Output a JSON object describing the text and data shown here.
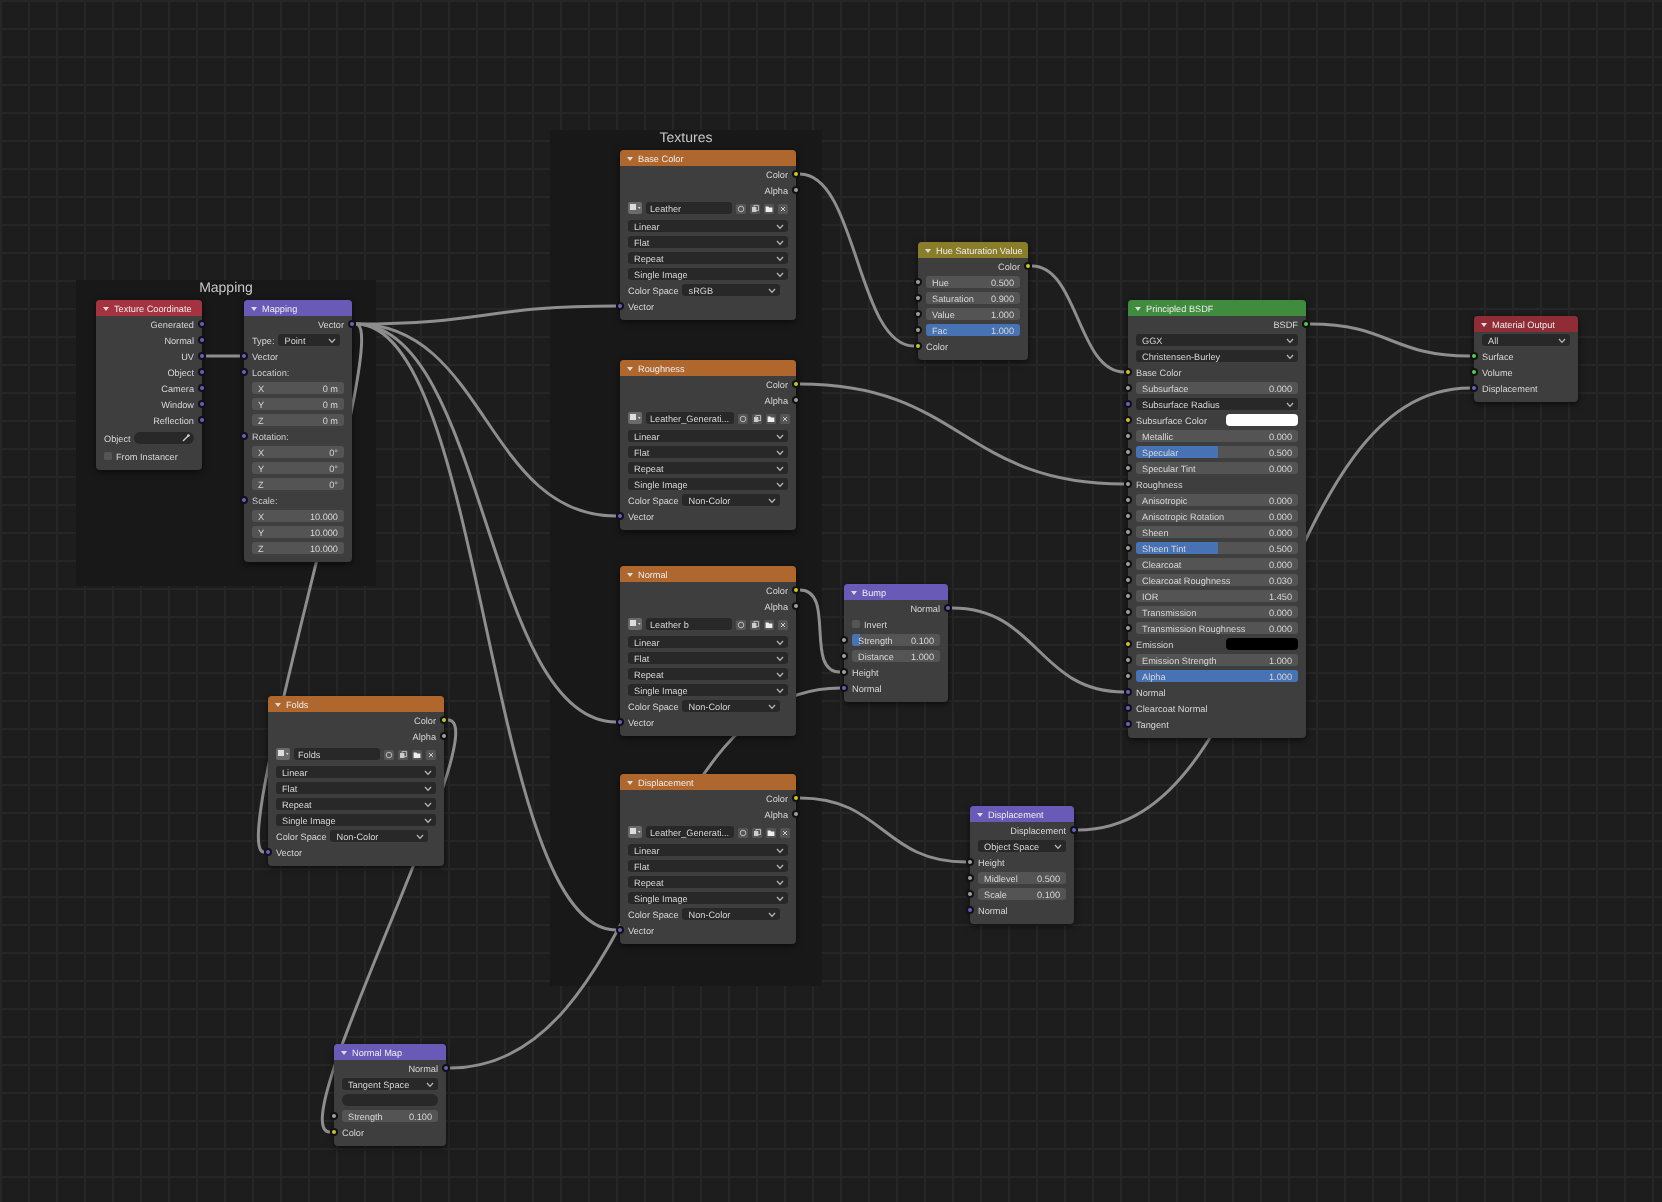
{
  "frames": [
    {
      "label": "Mapping"
    },
    {
      "label": "Textures"
    }
  ],
  "nodes": [
    {
      "title": "Texture Coordinate",
      "kind": "input",
      "rows": [
        {
          "kind": "output",
          "label": "Generated",
          "socket": {
            "kind": "vector"
          }
        },
        {
          "kind": "output",
          "label": "Normal",
          "socket": {
            "kind": "vector"
          }
        },
        {
          "kind": "output",
          "label": "UV",
          "socket": {
            "kind": "vector"
          }
        },
        {
          "kind": "output",
          "label": "Object",
          "socket": {
            "kind": "vector"
          }
        },
        {
          "kind": "output",
          "label": "Camera",
          "socket": {
            "kind": "vector"
          }
        },
        {
          "kind": "output",
          "label": "Window",
          "socket": {
            "kind": "vector"
          }
        },
        {
          "kind": "output",
          "label": "Reflection",
          "socket": {
            "kind": "vector"
          }
        },
        {
          "kind": "object",
          "label": "Object"
        },
        {
          "kind": "checkbox",
          "label": "From Instancer",
          "checked": false
        }
      ]
    },
    {
      "title": "Mapping",
      "kind": "vector",
      "rows": [
        {
          "kind": "output",
          "label": "Vector",
          "socket": {
            "kind": "vector"
          }
        },
        {
          "kind": "labeled_dropdown",
          "label": "Type:",
          "value": "Point"
        },
        {
          "kind": "input",
          "label": "Vector",
          "socket": {
            "kind": "vector"
          }
        },
        {
          "kind": "subheader",
          "label": "Location:",
          "socket": {
            "kind": "vector"
          }
        },
        {
          "kind": "value",
          "label": "X",
          "value": "0 m"
        },
        {
          "kind": "value",
          "label": "Y",
          "value": "0 m"
        },
        {
          "kind": "value",
          "label": "Z",
          "value": "0 m"
        },
        {
          "kind": "subheader",
          "label": "Rotation:",
          "socket": {
            "kind": "vector"
          }
        },
        {
          "kind": "value",
          "label": "X",
          "value": "0°"
        },
        {
          "kind": "value",
          "label": "Y",
          "value": "0°"
        },
        {
          "kind": "value",
          "label": "Z",
          "value": "0°"
        },
        {
          "kind": "subheader",
          "label": "Scale:",
          "socket": {
            "kind": "vector"
          }
        },
        {
          "kind": "value",
          "label": "X",
          "value": "10.000"
        },
        {
          "kind": "value",
          "label": "Y",
          "value": "10.000"
        },
        {
          "kind": "value",
          "label": "Z",
          "value": "10.000"
        }
      ]
    },
    {
      "title": "Base Color",
      "kind": "texture",
      "rows": [
        {
          "kind": "output",
          "label": "Color",
          "socket": {
            "kind": "color"
          }
        },
        {
          "kind": "output",
          "label": "Alpha",
          "socket": {
            "kind": "float"
          }
        },
        {
          "kind": "image",
          "value": "Leather"
        },
        {
          "kind": "dropdown",
          "value": "Linear"
        },
        {
          "kind": "dropdown",
          "value": "Flat"
        },
        {
          "kind": "dropdown",
          "value": "Repeat"
        },
        {
          "kind": "dropdown",
          "value": "Single Image"
        },
        {
          "kind": "labeled_dropdown",
          "label": "Color Space",
          "value": "sRGB"
        },
        {
          "kind": "input",
          "label": "Vector",
          "socket": {
            "kind": "vector"
          }
        }
      ]
    },
    {
      "title": "Roughness",
      "kind": "texture",
      "rows": [
        {
          "kind": "output",
          "label": "Color",
          "socket": {
            "kind": "color"
          }
        },
        {
          "kind": "output",
          "label": "Alpha",
          "socket": {
            "kind": "float"
          }
        },
        {
          "kind": "image",
          "value": "Leather_Generati..."
        },
        {
          "kind": "dropdown",
          "value": "Linear"
        },
        {
          "kind": "dropdown",
          "value": "Flat"
        },
        {
          "kind": "dropdown",
          "value": "Repeat"
        },
        {
          "kind": "dropdown",
          "value": "Single Image"
        },
        {
          "kind": "labeled_dropdown",
          "label": "Color Space",
          "value": "Non-Color"
        },
        {
          "kind": "input",
          "label": "Vector",
          "socket": {
            "kind": "vector"
          }
        }
      ]
    },
    {
      "title": "Normal",
      "kind": "texture",
      "rows": [
        {
          "kind": "output",
          "label": "Color",
          "socket": {
            "kind": "color"
          }
        },
        {
          "kind": "output",
          "label": "Alpha",
          "socket": {
            "kind": "float"
          }
        },
        {
          "kind": "image",
          "value": "Leather b"
        },
        {
          "kind": "dropdown",
          "value": "Linear"
        },
        {
          "kind": "dropdown",
          "value": "Flat"
        },
        {
          "kind": "dropdown",
          "value": "Repeat"
        },
        {
          "kind": "dropdown",
          "value": "Single Image"
        },
        {
          "kind": "labeled_dropdown",
          "label": "Color Space",
          "value": "Non-Color"
        },
        {
          "kind": "input",
          "label": "Vector",
          "socket": {
            "kind": "vector"
          }
        }
      ]
    },
    {
      "title": "Displacement",
      "kind": "texture",
      "rows": [
        {
          "kind": "output",
          "label": "Color",
          "socket": {
            "kind": "color"
          }
        },
        {
          "kind": "output",
          "label": "Alpha",
          "socket": {
            "kind": "float"
          }
        },
        {
          "kind": "image",
          "value": "Leather_Generati..."
        },
        {
          "kind": "dropdown",
          "value": "Linear"
        },
        {
          "kind": "dropdown",
          "value": "Flat"
        },
        {
          "kind": "dropdown",
          "value": "Repeat"
        },
        {
          "kind": "dropdown",
          "value": "Single Image"
        },
        {
          "kind": "labeled_dropdown",
          "label": "Color Space",
          "value": "Non-Color"
        },
        {
          "kind": "input",
          "label": "Vector",
          "socket": {
            "kind": "vector"
          }
        }
      ]
    },
    {
      "title": "Folds",
      "kind": "texture",
      "rows": [
        {
          "kind": "output",
          "label": "Color",
          "socket": {
            "kind": "color"
          }
        },
        {
          "kind": "output",
          "label": "Alpha",
          "socket": {
            "kind": "float"
          }
        },
        {
          "kind": "image",
          "value": "Folds"
        },
        {
          "kind": "dropdown",
          "value": "Linear"
        },
        {
          "kind": "dropdown",
          "value": "Flat"
        },
        {
          "kind": "dropdown",
          "value": "Repeat"
        },
        {
          "kind": "dropdown",
          "value": "Single Image"
        },
        {
          "kind": "labeled_dropdown",
          "label": "Color Space",
          "value": "Non-Color"
        },
        {
          "kind": "input",
          "label": "Vector",
          "socket": {
            "kind": "vector"
          }
        }
      ]
    },
    {
      "title": "Normal Map",
      "kind": "vector",
      "rows": [
        {
          "kind": "output",
          "label": "Normal",
          "socket": {
            "kind": "vector"
          }
        },
        {
          "kind": "dropdown",
          "value": "Tangent Space"
        },
        {
          "kind": "field"
        },
        {
          "kind": "value",
          "label": "Strength",
          "value": "0.100",
          "socket": {
            "kind": "float"
          }
        },
        {
          "kind": "input",
          "label": "Color",
          "socket": {
            "kind": "color"
          }
        }
      ]
    },
    {
      "title": "Hue Saturation Value",
      "kind": "color",
      "rows": [
        {
          "kind": "output",
          "label": "Color",
          "socket": {
            "kind": "color"
          }
        },
        {
          "kind": "value",
          "label": "Hue",
          "value": "0.500",
          "socket": {
            "kind": "float"
          }
        },
        {
          "kind": "value",
          "label": "Saturation",
          "value": "0.900",
          "socket": {
            "kind": "float"
          }
        },
        {
          "kind": "value",
          "label": "Value",
          "value": "1.000",
          "socket": {
            "kind": "float"
          }
        },
        {
          "kind": "value",
          "label": "Fac",
          "value": "1.000",
          "socket": {
            "kind": "float"
          },
          "level": 1
        },
        {
          "kind": "input",
          "label": "Color",
          "socket": {
            "kind": "color"
          }
        }
      ]
    },
    {
      "title": "Bump",
      "kind": "vector",
      "rows": [
        {
          "kind": "output",
          "label": "Normal",
          "socket": {
            "kind": "vector"
          }
        },
        {
          "kind": "checkbox",
          "label": "Invert",
          "checked": false
        },
        {
          "kind": "value",
          "label": "Strength",
          "value": "0.100",
          "socket": {
            "kind": "float"
          },
          "level": 0.1
        },
        {
          "kind": "value",
          "label": "Distance",
          "value": "1.000",
          "socket": {
            "kind": "float"
          }
        },
        {
          "kind": "input",
          "label": "Height",
          "socket": {
            "kind": "float"
          }
        },
        {
          "kind": "input",
          "label": "Normal",
          "socket": {
            "kind": "vector"
          }
        }
      ]
    },
    {
      "title": "Displacement",
      "kind": "vector",
      "rows": [
        {
          "kind": "output",
          "label": "Displacement",
          "socket": {
            "kind": "vector"
          }
        },
        {
          "kind": "dropdown",
          "value": "Object Space"
        },
        {
          "kind": "input",
          "label": "Height",
          "socket": {
            "kind": "float"
          }
        },
        {
          "kind": "value",
          "label": "Midlevel",
          "value": "0.500",
          "socket": {
            "kind": "float"
          }
        },
        {
          "kind": "value",
          "label": "Scale",
          "value": "0.100",
          "socket": {
            "kind": "float"
          }
        },
        {
          "kind": "input",
          "label": "Normal",
          "socket": {
            "kind": "vector"
          }
        }
      ]
    },
    {
      "title": "Principled BSDF",
      "kind": "shader",
      "rows": [
        {
          "kind": "output",
          "label": "BSDF",
          "socket": {
            "kind": "shader"
          }
        },
        {
          "kind": "dropdown",
          "value": "GGX"
        },
        {
          "kind": "dropdown",
          "value": "Christensen-Burley"
        },
        {
          "kind": "input",
          "label": "Base Color",
          "socket": {
            "kind": "color"
          }
        },
        {
          "kind": "value",
          "label": "Subsurface",
          "value": "0.000",
          "socket": {
            "kind": "float"
          }
        },
        {
          "kind": "dropdown",
          "value": "Subsurface Radius",
          "socket": {
            "kind": "vector"
          }
        },
        {
          "kind": "color",
          "label": "Subsurface Color",
          "socket": {
            "kind": "color"
          },
          "color": "#ffffff"
        },
        {
          "kind": "value",
          "label": "Metallic",
          "value": "0.000",
          "socket": {
            "kind": "float"
          }
        },
        {
          "kind": "value",
          "label": "Specular",
          "value": "0.500",
          "socket": {
            "kind": "float"
          },
          "level": 0.5
        },
        {
          "kind": "value",
          "label": "Specular Tint",
          "value": "0.000",
          "socket": {
            "kind": "float"
          }
        },
        {
          "kind": "input",
          "label": "Roughness",
          "socket": {
            "kind": "float"
          }
        },
        {
          "kind": "value",
          "label": "Anisotropic",
          "value": "0.000",
          "socket": {
            "kind": "float"
          }
        },
        {
          "kind": "value",
          "label": "Anisotropic Rotation",
          "value": "0.000",
          "socket": {
            "kind": "float"
          }
        },
        {
          "kind": "value",
          "label": "Sheen",
          "value": "0.000",
          "socket": {
            "kind": "float"
          }
        },
        {
          "kind": "value",
          "label": "Sheen Tint",
          "value": "0.500",
          "socket": {
            "kind": "float"
          },
          "level": 0.5
        },
        {
          "kind": "value",
          "label": "Clearcoat",
          "value": "0.000",
          "socket": {
            "kind": "float"
          }
        },
        {
          "kind": "value",
          "label": "Clearcoat Roughness",
          "value": "0.030",
          "socket": {
            "kind": "float"
          }
        },
        {
          "kind": "value",
          "label": "IOR",
          "value": "1.450",
          "socket": {
            "kind": "float"
          }
        },
        {
          "kind": "value",
          "label": "Transmission",
          "value": "0.000",
          "socket": {
            "kind": "float"
          }
        },
        {
          "kind": "value",
          "label": "Transmission Roughness",
          "value": "0.000",
          "socket": {
            "kind": "float"
          }
        },
        {
          "kind": "color",
          "label": "Emission",
          "socket": {
            "kind": "color"
          },
          "color": "#000000"
        },
        {
          "kind": "value",
          "label": "Emission Strength",
          "value": "1.000",
          "socket": {
            "kind": "float"
          }
        },
        {
          "kind": "value",
          "label": "Alpha",
          "value": "1.000",
          "socket": {
            "kind": "float"
          },
          "level": 1
        },
        {
          "kind": "input",
          "label": "Normal",
          "socket": {
            "kind": "vector"
          }
        },
        {
          "kind": "input",
          "label": "Clearcoat Normal",
          "socket": {
            "kind": "vector"
          }
        },
        {
          "kind": "input",
          "label": "Tangent",
          "socket": {
            "kind": "vector"
          }
        }
      ]
    },
    {
      "title": "Material Output",
      "kind": "output",
      "rows": [
        {
          "kind": "dropdown",
          "value": "All"
        },
        {
          "kind": "input",
          "label": "Surface",
          "socket": {
            "kind": "shader"
          }
        },
        {
          "kind": "input",
          "label": "Volume",
          "socket": {
            "kind": "shader"
          }
        },
        {
          "kind": "input",
          "label": "Displacement",
          "socket": {
            "kind": "vector"
          }
        }
      ]
    }
  ]
}
